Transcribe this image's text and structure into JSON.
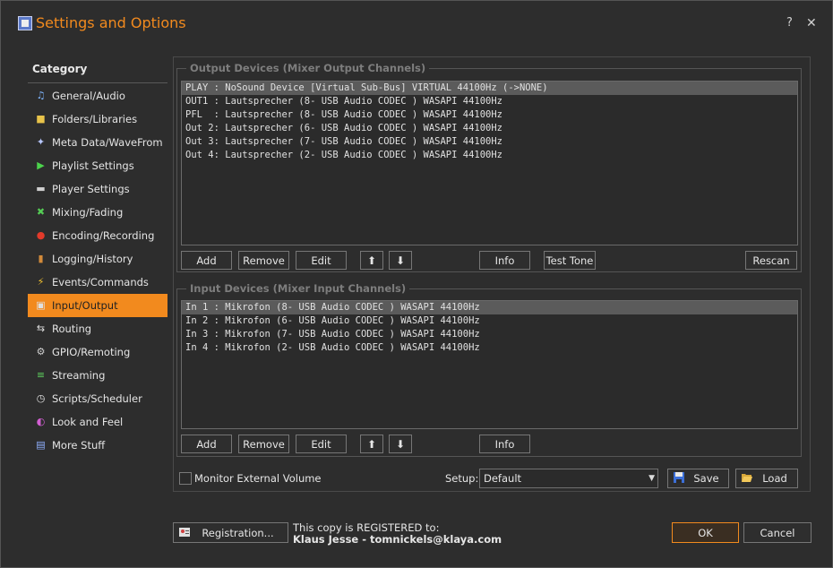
{
  "window": {
    "title": "Settings and Options",
    "help": "?",
    "close": "✕"
  },
  "sidebar": {
    "heading": "Category",
    "items": [
      {
        "label": "General/Audio",
        "icon": "♫",
        "color": "#7fb6ff"
      },
      {
        "label": "Folders/Libraries",
        "icon": "■",
        "color": "#e8c34a"
      },
      {
        "label": "Meta Data/WaveFrom",
        "icon": "✦",
        "color": "#b7c7ff"
      },
      {
        "label": "Playlist Settings",
        "icon": "▶",
        "color": "#4cd34c"
      },
      {
        "label": "Player Settings",
        "icon": "▬",
        "color": "#cfcfcf"
      },
      {
        "label": "Mixing/Fading",
        "icon": "✖",
        "color": "#55cc55"
      },
      {
        "label": "Encoding/Recording",
        "icon": "●",
        "color": "#e23a2a"
      },
      {
        "label": "Logging/History",
        "icon": "▮",
        "color": "#d28a3a"
      },
      {
        "label": "Events/Commands",
        "icon": "⚡",
        "color": "#f2c12e"
      },
      {
        "label": "Input/Output",
        "icon": "▣",
        "color": "#e0e0e0"
      },
      {
        "label": "Routing",
        "icon": "⇆",
        "color": "#e0e0e0"
      },
      {
        "label": "GPIO/Remoting",
        "icon": "⚙",
        "color": "#cfcfcf"
      },
      {
        "label": "Streaming",
        "icon": "≡",
        "color": "#5fd35f"
      },
      {
        "label": "Scripts/Scheduler",
        "icon": "◷",
        "color": "#e0e0e0"
      },
      {
        "label": "Look and Feel",
        "icon": "◐",
        "color": "#d35fd3"
      },
      {
        "label": "More Stuff",
        "icon": "▤",
        "color": "#8fb0ff"
      }
    ],
    "active_index": 9
  },
  "output": {
    "legend": "Output Devices (Mixer Output Channels)",
    "rows": [
      "PLAY : NoSound Device [Virtual Sub-Bus] VIRTUAL 44100Hz (->NONE)",
      "OUT1 : Lautsprecher (8- USB Audio CODEC ) WASAPI 44100Hz",
      "PFL  : Lautsprecher (8- USB Audio CODEC ) WASAPI 44100Hz",
      "Out 2: Lautsprecher (6- USB Audio CODEC ) WASAPI 44100Hz",
      "Out 3: Lautsprecher (7- USB Audio CODEC ) WASAPI 44100Hz",
      "Out 4: Lautsprecher (2- USB Audio CODEC ) WASAPI 44100Hz"
    ],
    "selected": 0,
    "buttons": {
      "add": "Add",
      "remove": "Remove",
      "edit": "Edit",
      "up": "⬆",
      "down": "⬇",
      "info": "Info",
      "test_tone": "Test Tone",
      "rescan": "Rescan"
    }
  },
  "input": {
    "legend": "Input Devices (Mixer Input Channels)",
    "rows": [
      "In 1 : Mikrofon (8- USB Audio CODEC ) WASAPI 44100Hz",
      "In 2 : Mikrofon (6- USB Audio CODEC ) WASAPI 44100Hz",
      "In 3 : Mikrofon (7- USB Audio CODEC ) WASAPI 44100Hz",
      "In 4 : Mikrofon (2- USB Audio CODEC ) WASAPI 44100Hz"
    ],
    "selected": 0,
    "buttons": {
      "add": "Add",
      "remove": "Remove",
      "edit": "Edit",
      "up": "⬆",
      "down": "⬇",
      "info": "Info"
    }
  },
  "bottom": {
    "monitor_label": "Monitor External Volume",
    "monitor_checked": false,
    "setup_label": "Setup:",
    "setup_value": "Default",
    "save": "Save",
    "load": "Load"
  },
  "footer": {
    "registration": "Registration...",
    "registered_line": "This copy is REGISTERED to:",
    "registered_user": "Klaus Jesse - tomnickels@klaya.com",
    "ok": "OK",
    "cancel": "Cancel"
  },
  "colors": {
    "accent": "#f28a1e",
    "background": "#2d2d2d"
  }
}
